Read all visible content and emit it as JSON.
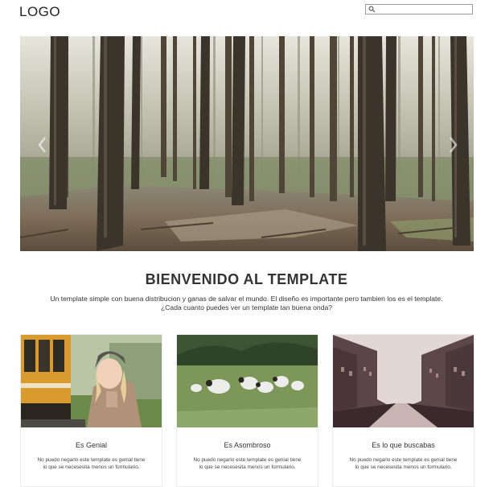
{
  "header": {
    "logo": "LOGO",
    "search": {
      "placeholder": "",
      "value": "",
      "icon": "search-icon"
    }
  },
  "hero": {
    "image": "forest-photo",
    "prev_icon": "chevron-left-icon",
    "next_icon": "chevron-right-icon"
  },
  "intro": {
    "title": "BIENVENIDO AL TEMPLATE",
    "line1": "Un template simple con buena distribucion y ganas de salvar el mundo. El diseño es importante pero tambien los es el template.",
    "line2": "¿Cada cuanto puedes ver un template tan buena onda?"
  },
  "cards": [
    {
      "image": "woman-tram-photo",
      "title": "Es Genial",
      "text1": "No puedo negarlo este template es genial tiene",
      "text2": "lo que se necesesita menos un formulario."
    },
    {
      "image": "sheep-field-photo",
      "title": "Es Asombroso",
      "text1": "No puedo negarlo este template es genial tiene",
      "text2": "lo que se necesesita menos un formulario."
    },
    {
      "image": "canal-city-photo",
      "title": "Es lo que buscabas",
      "text1": "No puedo negarlo este template es genial tiene",
      "text2": "lo que se necesesita menos un formulario."
    }
  ],
  "colors": {
    "text": "#333333",
    "border": "#ececec",
    "search_border": "#9a9a9a"
  }
}
